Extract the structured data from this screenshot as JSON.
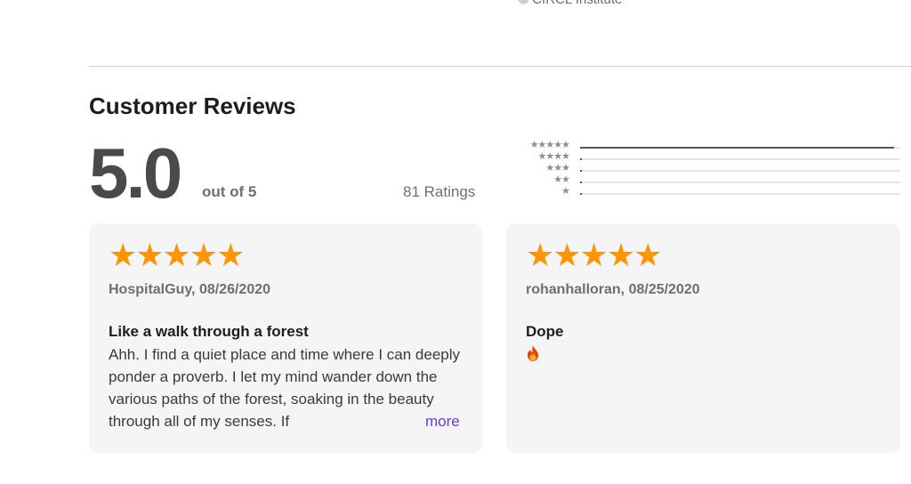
{
  "footer": {
    "copyright": "© CIRCL Institute"
  },
  "reviews_section": {
    "title": "Customer Reviews",
    "score": "5.0",
    "out_of": "out of 5",
    "ratings_count": "81 Ratings",
    "histogram": [
      {
        "stars": "★★★★★",
        "fraction": 0.98
      },
      {
        "stars": "★★★★",
        "fraction": 0.0
      },
      {
        "stars": "★★★",
        "fraction": 0.0
      },
      {
        "stars": "★★",
        "fraction": 0.0
      },
      {
        "stars": "★",
        "fraction": 0.0
      }
    ]
  },
  "reviews": [
    {
      "stars": "★★★★★",
      "rating": 5,
      "meta": "HospitalGuy, 08/26/2020",
      "title": "Like a walk through a forest",
      "body": "Ahh. I find a quiet place and time where I can deeply ponder a proverb. I let my mind wander down the various paths of the forest, soaking in the beauty through all of my senses. If",
      "more_label": "more"
    },
    {
      "stars": "★★★★★",
      "rating": 5,
      "meta": "rohanhalloran, 08/25/2020",
      "title": "Dope",
      "body_icon": "fire-emoji-icon"
    }
  ],
  "colors": {
    "star": "#ff9500",
    "more_link": "#6e3bd6",
    "card_bg": "#f5f5f7"
  }
}
